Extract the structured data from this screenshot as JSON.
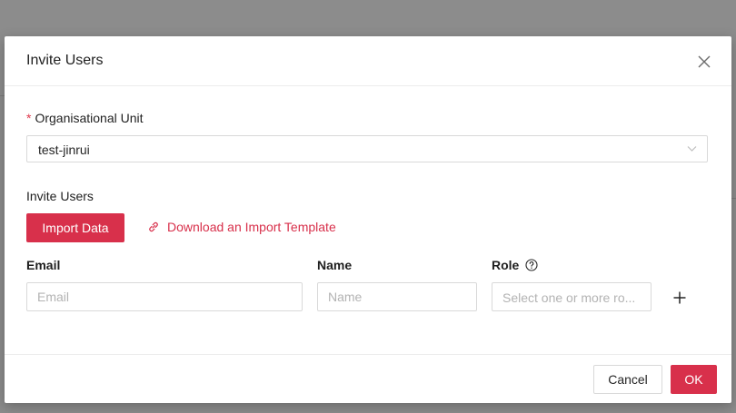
{
  "modal": {
    "title": "Invite Users"
  },
  "org_unit": {
    "required_mark": "*",
    "label": "Organisational Unit",
    "value": "test-jinrui"
  },
  "invite_section": {
    "label": "Invite Users",
    "import_button": "Import Data",
    "template_link": "Download an Import Template"
  },
  "table": {
    "headers": {
      "email": "Email",
      "name": "Name",
      "role": "Role"
    },
    "row": {
      "email_placeholder": "Email",
      "name_placeholder": "Name",
      "role_placeholder": "Select one or more ro..."
    }
  },
  "footer": {
    "cancel": "Cancel",
    "ok": "OK"
  },
  "colors": {
    "accent": "#d8304b",
    "overlay": "#8c8c8c"
  },
  "icons": {
    "close": "close-icon",
    "dropdown": "chevron-down-icon",
    "link": "link-icon",
    "help": "question-circle-icon",
    "add": "plus-icon"
  }
}
